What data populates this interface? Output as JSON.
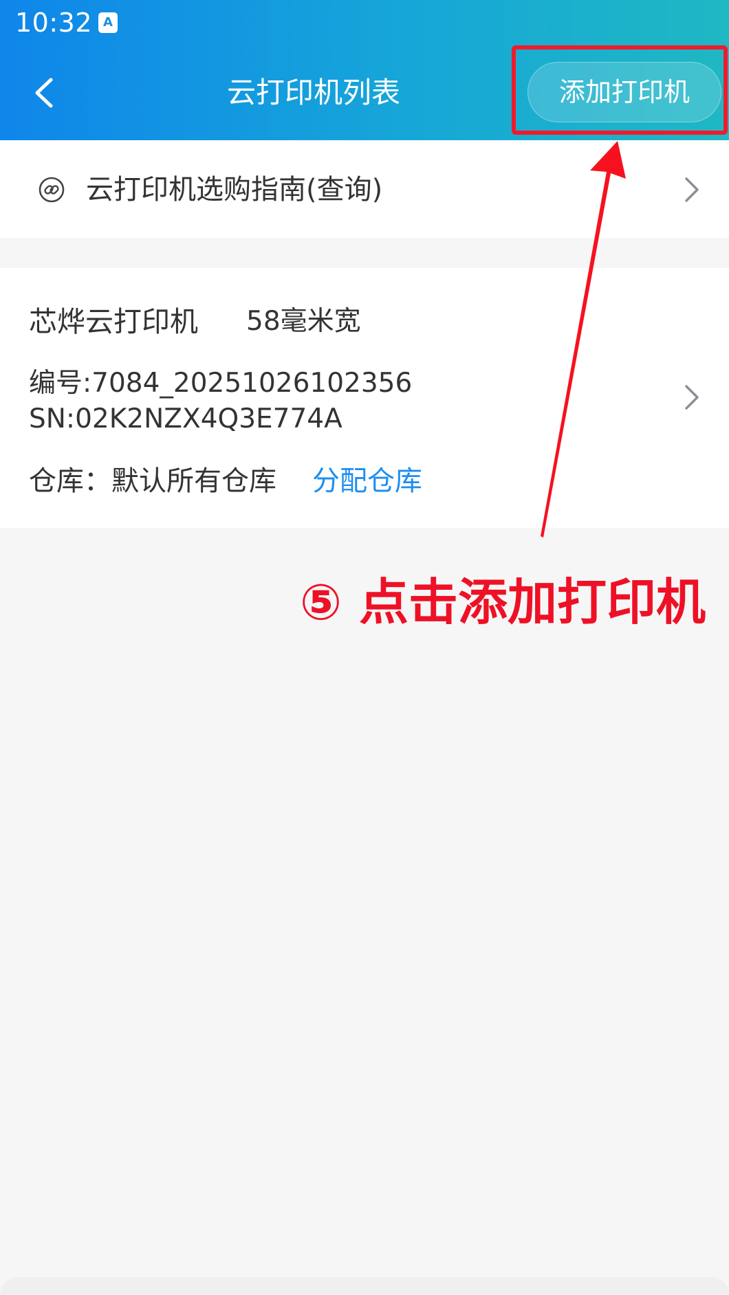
{
  "status_bar": {
    "time": "10:32",
    "badge_label": "A"
  },
  "header": {
    "title": "云打印机列表",
    "back_icon": "chevron-left-icon",
    "add_button_label": "添加打印机"
  },
  "guide": {
    "icon": "link-circle-icon",
    "label": "云打印机选购指南(查询)"
  },
  "printers": [
    {
      "name": "芯烨云打印机",
      "paper_width": "58毫米宽",
      "number": "编号:7084_20251026102356",
      "sn": "SN:02K2NZX4Q3E774A",
      "warehouse": "仓库：默认所有仓库",
      "assign_label": "分配仓库"
    }
  ],
  "annotation": {
    "text": "⑤ 点击添加打印机",
    "color": "#ee1126"
  },
  "colors": {
    "header_start": "#0f86ea",
    "header_end": "#1fb8c3",
    "link_blue": "#1e8ef0",
    "highlight_red": "#f11a2c"
  }
}
